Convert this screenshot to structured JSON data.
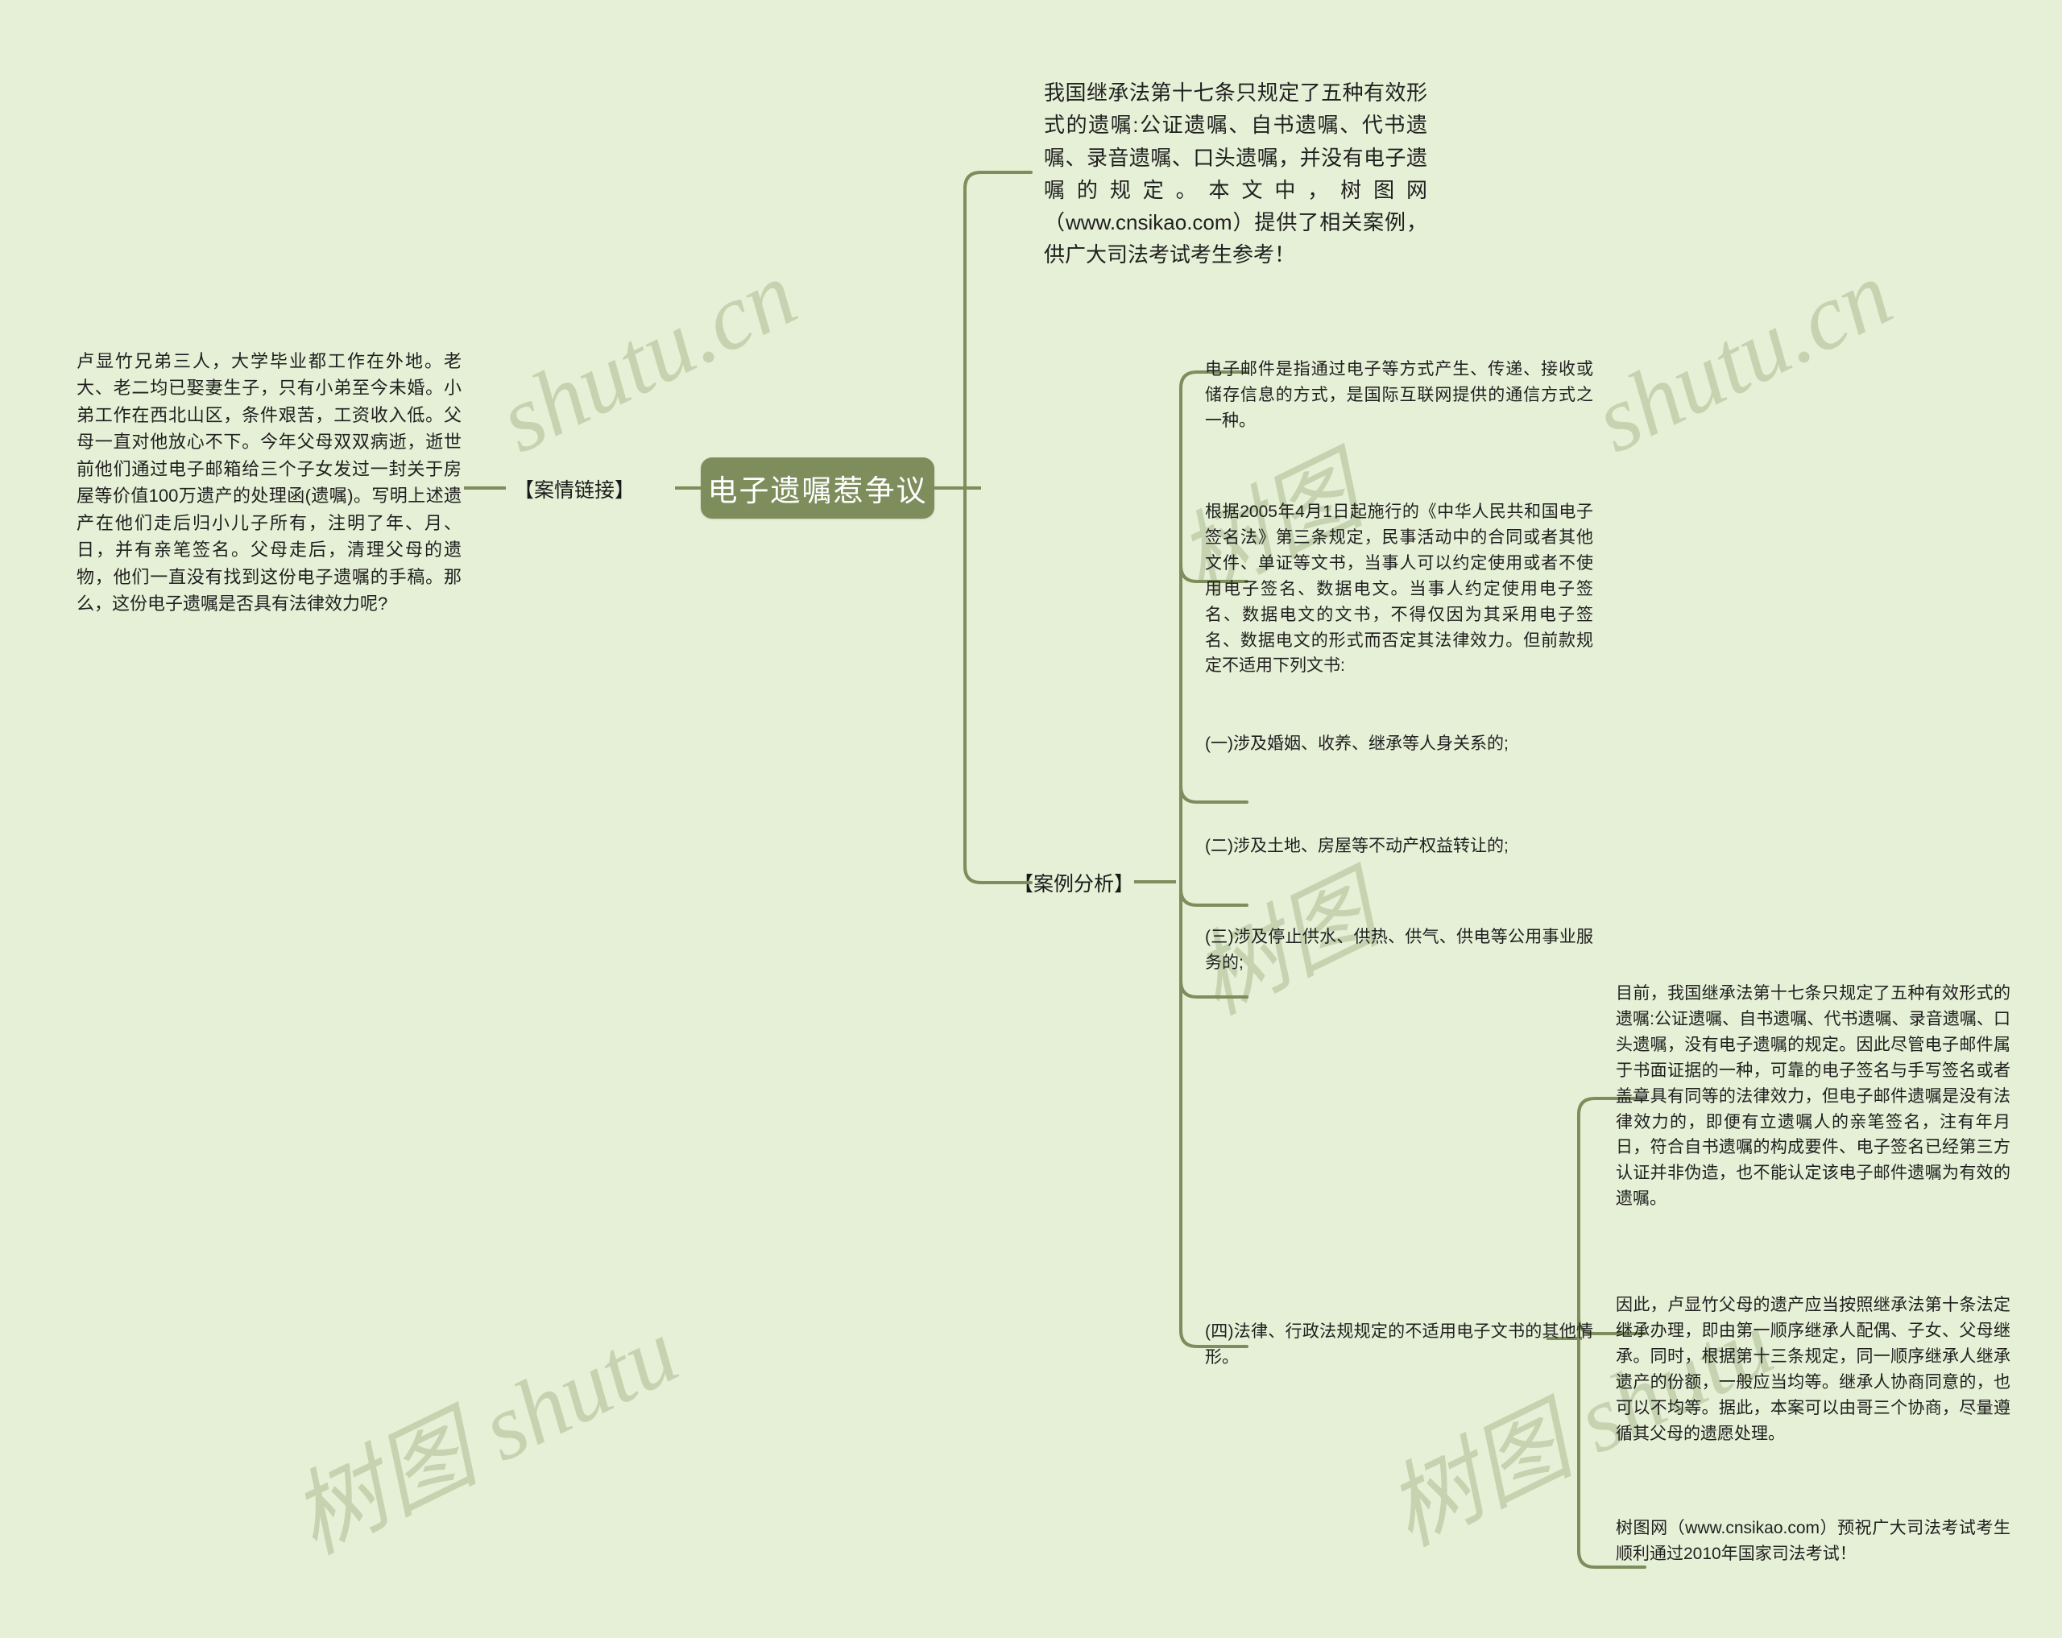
{
  "canvas": {
    "background_color": "#e6f0d6",
    "accent_color": "#7d8d5c",
    "text_color": "#1f1f1f",
    "watermark_color": "#c5d3b0"
  },
  "watermarks": [
    {
      "text": "shutu.cn"
    },
    {
      "text": "shutu.cn"
    },
    {
      "text": "树图 shutu"
    },
    {
      "text": "树图 shutu"
    },
    {
      "text": "树图"
    }
  ],
  "root": {
    "label": "电子遗嘱惹争议"
  },
  "branches": {
    "case_link": {
      "label": "【案情链接】",
      "body": "卢显竹兄弟三人，大学毕业都工作在外地。老大、老二均已娶妻生子，只有小弟至今未婚。小弟工作在西北山区，条件艰苦，工资收入低。父母一直对他放心不下。今年父母双双病逝，逝世前他们通过电子邮箱给三个子女发过一封关于房屋等价值100万遗产的处理函(遗嘱)。写明上述遗产在他们走后归小儿子所有，注明了年、月、日，并有亲笔签名。父母走后，清理父母的遗物，他们一直没有找到这份电子遗嘱的手稿。那么，这份电子遗嘱是否具有法律效力呢?"
    },
    "intro": {
      "body": "我国继承法第十七条只规定了五种有效形式的遗嘱:公证遗嘱、自书遗嘱、代书遗嘱、录音遗嘱、口头遗嘱，并没有电子遗嘱的规定。本文中，树图网（www.cnsikao.com）提供了相关案例，供广大司法考试考生参考！"
    },
    "case_analysis": {
      "label": "【案例分析】",
      "children": [
        {
          "id": "email-definition",
          "body": "电子邮件是指通过电子等方式产生、传递、接收或储存信息的方式，是国际互联网提供的通信方式之一种。"
        },
        {
          "id": "e-signature-law",
          "body": "根据2005年4月1日起施行的《中华人民共和国电子签名法》第三条规定，民事活动中的合同或者其他文件、单证等文书，当事人可以约定使用或者不使用电子签名、数据电文。当事人约定使用电子签名、数据电文的文书，不得仅因为其采用电子签名、数据电文的形式而否定其法律效力。但前款规定不适用下列文书:"
        },
        {
          "id": "exclusion-1",
          "body": "(一)涉及婚姻、收养、继承等人身关系的;"
        },
        {
          "id": "exclusion-2",
          "body": "(二)涉及土地、房屋等不动产权益转让的;"
        },
        {
          "id": "exclusion-3",
          "body": "(三)涉及停止供水、供热、供气、供电等公用事业服务的;"
        },
        {
          "id": "exclusion-4",
          "body": "(四)法律、行政法规规定的不适用电子文书的其他情形。",
          "children": [
            {
              "id": "conclusion-validity",
              "body": "目前，我国继承法第十七条只规定了五种有效形式的遗嘱:公证遗嘱、自书遗嘱、代书遗嘱、录音遗嘱、口头遗嘱，没有电子遗嘱的规定。因此尽管电子邮件属于书面证据的一种，可靠的电子签名与手写签名或者盖章具有同等的法律效力，但电子邮件遗嘱是没有法律效力的，即便有立遗嘱人的亲笔签名，注有年月日，符合自书遗嘱的构成要件、电子签名已经第三方认证并非伪造，也不能认定该电子邮件遗嘱为有效的遗嘱。"
            },
            {
              "id": "conclusion-inheritance",
              "body": "因此，卢显竹父母的遗产应当按照继承法第十条法定继承办理，即由第一顺序继承人配偶、子女、父母继承。同时，根据第十三条规定，同一顺序继承人继承遗产的份额，一般应当均等。继承人协商同意的，也可以不均等。据此，本案可以由哥三个协商，尽量遵循其父母的遗愿处理。"
            },
            {
              "id": "closing-wishes",
              "body": "树图网（www.cnsikao.com）预祝广大司法考试考生顺利通过2010年国家司法考试！"
            }
          ]
        }
      ]
    }
  }
}
